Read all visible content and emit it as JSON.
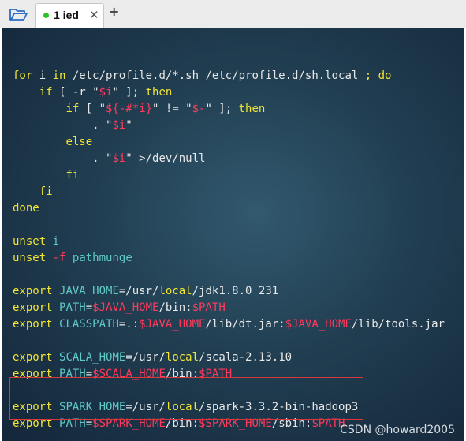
{
  "tabbar": {
    "tab_label": "1 ied",
    "tab_close": "✕",
    "add_tab": "+",
    "status_color": "#2ec12e"
  },
  "terminal": {
    "lines": [
      [],
      [
        [
          "kw",
          "for"
        ],
        [
          "pl",
          " i "
        ],
        [
          "kw",
          "in"
        ],
        [
          "pl",
          " /etc/profile.d/*.sh /etc/profile.d/sh.local "
        ],
        [
          "kw",
          ";"
        ],
        [
          "pl",
          " "
        ],
        [
          "kw",
          "do"
        ]
      ],
      [
        [
          "pl",
          "    "
        ],
        [
          "kw",
          "if"
        ],
        [
          "pl",
          " [ -r \""
        ],
        [
          "red",
          "$i"
        ],
        [
          "pl",
          "\" ]; "
        ],
        [
          "kw",
          "then"
        ]
      ],
      [
        [
          "pl",
          "        "
        ],
        [
          "kw",
          "if"
        ],
        [
          "pl",
          " [ \""
        ],
        [
          "red",
          "${-#*i}"
        ],
        [
          "pl",
          "\" != \""
        ],
        [
          "red",
          "$-"
        ],
        [
          "pl",
          "\" ]; "
        ],
        [
          "kw",
          "then"
        ]
      ],
      [
        [
          "pl",
          "            . \""
        ],
        [
          "red",
          "$i"
        ],
        [
          "pl",
          "\""
        ]
      ],
      [
        [
          "pl",
          "        "
        ],
        [
          "kw",
          "else"
        ]
      ],
      [
        [
          "pl",
          "            . \""
        ],
        [
          "red",
          "$i"
        ],
        [
          "pl",
          "\" >/dev/null"
        ]
      ],
      [
        [
          "pl",
          "        "
        ],
        [
          "kw",
          "fi"
        ]
      ],
      [
        [
          "pl",
          "    "
        ],
        [
          "kw",
          "fi"
        ]
      ],
      [
        [
          "kw",
          "done"
        ]
      ],
      [],
      [
        [
          "kw",
          "unset"
        ],
        [
          "pl",
          " "
        ],
        [
          "vn",
          "i"
        ]
      ],
      [
        [
          "kw",
          "unset"
        ],
        [
          "pl",
          " "
        ],
        [
          "red",
          "-f"
        ],
        [
          "pl",
          " "
        ],
        [
          "vn",
          "pathmunge"
        ]
      ],
      [],
      [
        [
          "kw",
          "export"
        ],
        [
          "pl",
          " "
        ],
        [
          "vn",
          "JAVA_HOME"
        ],
        [
          "pl",
          "=/usr/"
        ],
        [
          "kw",
          "local"
        ],
        [
          "pl",
          "/jdk1.8.0_231"
        ]
      ],
      [
        [
          "kw",
          "export"
        ],
        [
          "pl",
          " "
        ],
        [
          "vn",
          "PATH"
        ],
        [
          "pl",
          "="
        ],
        [
          "red",
          "$JAVA_HOME"
        ],
        [
          "pl",
          "/bin:"
        ],
        [
          "red",
          "$PATH"
        ]
      ],
      [
        [
          "kw",
          "export"
        ],
        [
          "pl",
          " "
        ],
        [
          "vn",
          "CLASSPATH"
        ],
        [
          "pl",
          "=.:"
        ],
        [
          "red",
          "$JAVA_HOME"
        ],
        [
          "pl",
          "/lib/dt.jar:"
        ],
        [
          "red",
          "$JAVA_HOME"
        ],
        [
          "pl",
          "/lib/tools.jar"
        ]
      ],
      [],
      [
        [
          "kw",
          "export"
        ],
        [
          "pl",
          " "
        ],
        [
          "vn",
          "SCALA_HOME"
        ],
        [
          "pl",
          "=/usr/"
        ],
        [
          "kw",
          "local"
        ],
        [
          "pl",
          "/scala-2.13.10"
        ]
      ],
      [
        [
          "kw",
          "export"
        ],
        [
          "pl",
          " "
        ],
        [
          "vn",
          "PATH"
        ],
        [
          "pl",
          "="
        ],
        [
          "red",
          "$SCALA_HOME"
        ],
        [
          "pl",
          "/bin:"
        ],
        [
          "red",
          "$PATH"
        ]
      ],
      [],
      [
        [
          "kw",
          "export"
        ],
        [
          "pl",
          " "
        ],
        [
          "vn",
          "SPARK_HOME"
        ],
        [
          "pl",
          "=/usr/"
        ],
        [
          "kw",
          "local"
        ],
        [
          "pl",
          "/spark-3.3.2-bin-hadoop3"
        ]
      ],
      [
        [
          "kw",
          "export"
        ],
        [
          "pl",
          " "
        ],
        [
          "vn",
          "PATH"
        ],
        [
          "pl",
          "="
        ],
        [
          "red",
          "$SPARK_HOME"
        ],
        [
          "pl",
          "/bin:"
        ],
        [
          "red",
          "$SPARK_HOME"
        ],
        [
          "pl",
          "/sbin:"
        ],
        [
          "red",
          "$PATH"
        ]
      ]
    ]
  },
  "watermark": "CSDN @howard2005"
}
